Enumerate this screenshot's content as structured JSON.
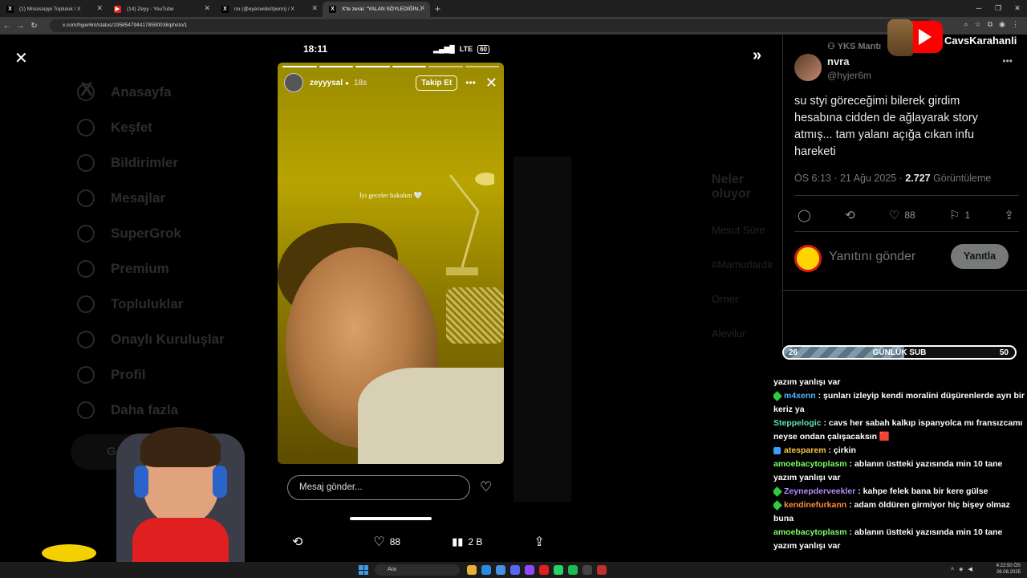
{
  "browser": {
    "tabs": [
      {
        "label": "(1) Mississippi Topluluk / X",
        "icon": "x-icon"
      },
      {
        "label": "(14) Zeyy - YouTube",
        "icon": "youtube-icon"
      },
      {
        "label": "no (@eyeswide0penn) / X",
        "icon": "x-icon"
      },
      {
        "label": "X'te zerai: \"YALAN SÖYLEDİĞİN...",
        "icon": "x-icon"
      }
    ],
    "new_tab": "+",
    "url": "x.com/hyjer6m/status/1958547944178590038/photo/1"
  },
  "background_nav": {
    "items": [
      "Anasayfa",
      "Keşfet",
      "Bildirimler",
      "Mesajlar",
      "SuperGrok",
      "Premium",
      "Topluluklar",
      "Onaylı Kuruluşlar",
      "Profil",
      "Daha fazla"
    ],
    "post_button": "Gönder"
  },
  "background_sidebar": {
    "heading": "Neler oluyor",
    "items": [
      "Mesut Süre",
      "#Mamurlardir",
      "Orner",
      "Alevilur"
    ]
  },
  "story": {
    "status_time": "18:11",
    "network": "LTE",
    "battery": "60",
    "username": "zeyyysal",
    "time_ago": "18s",
    "follow_label": "Takip Et",
    "caption": "İyi geceler bakalım 🤍",
    "message_placeholder": "Mesaj gönder...",
    "progress_segments": 6,
    "progress_done": 4
  },
  "bottom_actions": {
    "likes": "88",
    "views": "2 B"
  },
  "tweet": {
    "community": "YKS Mantı",
    "display_name": "nvra",
    "handle": "@hyjer6m",
    "text": "su styi göreceğimi bilerek girdim hesabına cidden de ağlayarak story atmış... tam yalanı açığa cıkan infu hareketi",
    "timestamp": "ÖS 6:13 · 21 Ağu 2025 ·",
    "views_count": "2.727",
    "views_label": "Görüntüleme",
    "likes": "88",
    "bookmarks": "1",
    "reply_placeholder": "Yanıtını gönder",
    "reply_button": "Yanıtla"
  },
  "stream": {
    "channel": "CavsKarahanli",
    "sub_goal": {
      "current": "26",
      "label": "GÜNLÜK SUB",
      "target": "50",
      "fraction": 0.52
    },
    "chat": [
      {
        "user": "",
        "text": "yazım yanlışı var",
        "color": "#ffffff",
        "badge": ""
      },
      {
        "user": "m4xenn",
        "text": ": şunları izleyip kendi moralini düşürenlerde ayrı bir keriz ya",
        "color": "#4fb6ff",
        "badge": "green"
      },
      {
        "user": "Steppelogic",
        "text": ": cavs her sabah kalkıp ispanyolca mı fransızcamı neyse ondan çalışacaksın 🟥",
        "color": "#5fe3c0",
        "badge": ""
      },
      {
        "user": "atesparem",
        "text": ": çirkin",
        "color": "#f5c542",
        "badge": "blue"
      },
      {
        "user": "amoebacytoplasm",
        "text": ": ablanın üstteki yazısında min 10 tane yazım yanlışı var",
        "color": "#7cfc66",
        "badge": ""
      },
      {
        "user": "Zeynepderveekler",
        "text": ": kahpe felek bana bir kere gülse",
        "color": "#b48cff",
        "badge": "green"
      },
      {
        "user": "kendinefurkann",
        "text": ": adam öldüren girmiyor hiç bişey olmaz buna",
        "color": "#ff8c3a",
        "badge": "green"
      },
      {
        "user": "amoebacytoplasm",
        "text": ": ablanın üstteki yazısında min 10 tane yazım yanlışı var",
        "color": "#7cfc66",
        "badge": ""
      }
    ]
  },
  "taskbar": {
    "search_placeholder": "Ara",
    "time": "4:22:50 ÖS",
    "date": "26.08.2025"
  },
  "colors": {
    "x_black": "#000000",
    "x_text": "#e7e9ea",
    "x_muted": "#71767b",
    "youtube_red": "#ff0000"
  }
}
